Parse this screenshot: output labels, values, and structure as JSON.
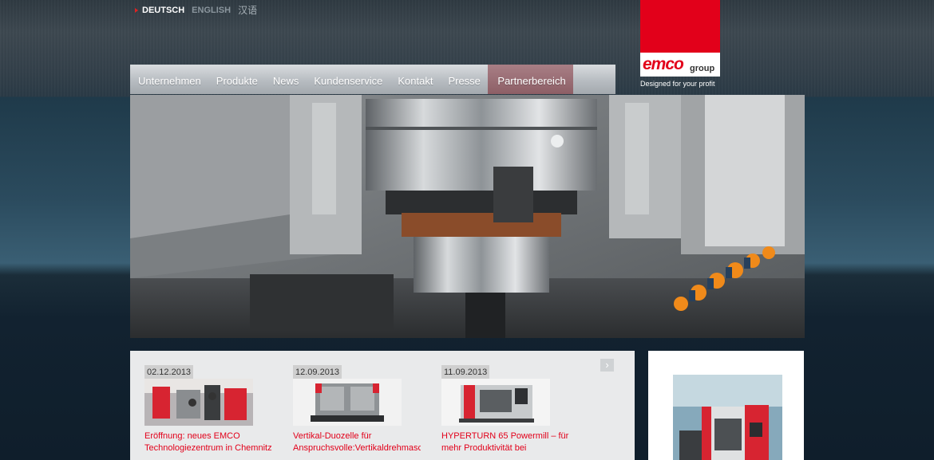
{
  "language_bar": {
    "active": "DEUTSCH",
    "english": "ENGLISH",
    "chinese": "汉语"
  },
  "brand": {
    "logo_text": "emco",
    "logo_suffix": "group",
    "tagline": "Designed for your profit",
    "color": "#e2001a"
  },
  "nav": {
    "items": [
      "Unternehmen",
      "Produkte",
      "News",
      "Kundenservice",
      "Kontakt",
      "Presse",
      "Partnerbereich"
    ],
    "active_index": 6
  },
  "hero": {
    "image": "machine-chuck-photo"
  },
  "news": {
    "next_icon": "›",
    "items": [
      {
        "date": "02.12.2013",
        "title_line1": "Eröffnung: neues EMCO",
        "title_line2": "Technologiezentrum in Chemnitz"
      },
      {
        "date": "12.09.2013",
        "title_line1": "Vertikal-Duozelle für",
        "title_line2": "Anspruchsvolle:Vertikaldrehmasc"
      },
      {
        "date": "11.09.2013",
        "title_line1": "HYPERTURN 65 Powermill – für",
        "title_line2": "mehr Produktivität bei"
      }
    ]
  }
}
